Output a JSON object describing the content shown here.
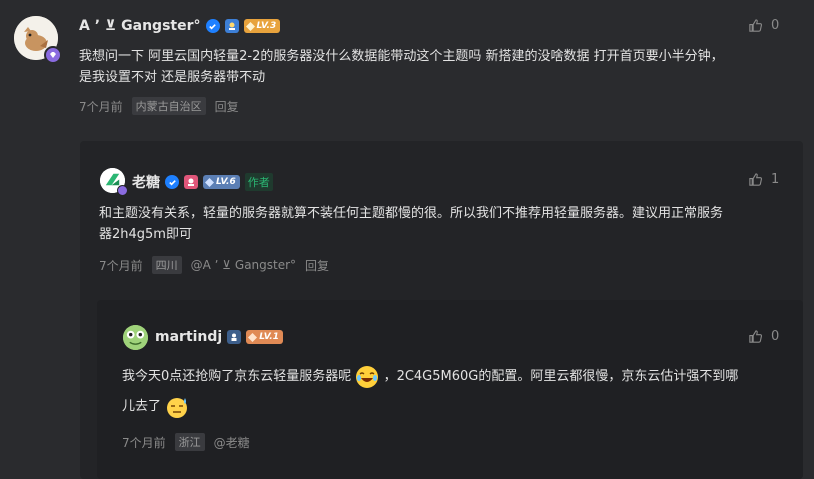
{
  "comments": [
    {
      "username": "A ʼ ⊻ Gangster°",
      "level": "LV.3",
      "text_lines": [
        "我想问一下 阿里云国内轻量2-2的服务器没什么数据能带动这个主题吗  新搭建的没啥数据 打开首页要小半分钟，",
        "是我设置不对 还是服务器带不动"
      ],
      "time": "7个月前",
      "location": "内蒙古自治区",
      "reply_label": "回复",
      "likes": "0"
    },
    {
      "username": "老糖",
      "level": "LV.6",
      "author_tag": "作者",
      "text_lines": [
        "和主题没有关系，轻量的服务器就算不装任何主题都慢的很。所以我们不推荐用轻量服务器。建议用正常服务",
        "器2h4g5m即可"
      ],
      "time": "7个月前",
      "location": "四川",
      "mention": "@A ʼ ⊻ Gangster°",
      "reply_label": "回复",
      "likes": "1"
    },
    {
      "username": "martindj",
      "level": "LV.1",
      "text_line1_a": "我今天0点还抢购了京东云轻量服务器呢",
      "text_line1_b": "，2C4G5M60G的配置。阿里云都很慢，京东云估计强不到哪",
      "text_line2": "儿去了",
      "time": "7个月前",
      "location": "浙江",
      "mention": "@老糖",
      "likes": "0"
    }
  ],
  "colors": {
    "background": "#2a2b2e",
    "verified": "#1e80ff",
    "lv3": "#e8a33d",
    "lv6": "#5b7fb5",
    "lv1": "#e08a55",
    "author_tag": "#2bb673"
  },
  "icons": [
    "like-icon",
    "verified-icon",
    "avatar-frame-icon",
    "emoji-laugh-icon",
    "emoji-sweat-icon"
  ]
}
